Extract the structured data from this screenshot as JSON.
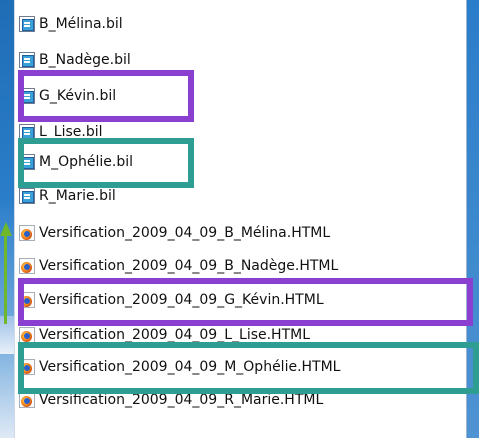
{
  "files": [
    {
      "name": "B_Mélina.bil",
      "icon": "bil-document-icon"
    },
    {
      "name": "B_Nadège.bil",
      "icon": "bil-document-icon"
    },
    {
      "name": "G_Kévin.bil",
      "icon": "bil-document-icon"
    },
    {
      "name": "L_Lise.bil",
      "icon": "bil-document-icon"
    },
    {
      "name": "M_Ophélie.bil",
      "icon": "bil-document-icon"
    },
    {
      "name": "R_Marie.bil",
      "icon": "bil-document-icon"
    },
    {
      "name": "Versification_2009_04_09_B_Mélina.HTML",
      "icon": "firefox-html-icon"
    },
    {
      "name": "Versification_2009_04_09_B_Nadège.HTML",
      "icon": "firefox-html-icon"
    },
    {
      "name": "Versification_2009_04_09_G_Kévin.HTML",
      "icon": "firefox-html-icon"
    },
    {
      "name": "Versification_2009_04_09_L_Lise.HTML",
      "icon": "firefox-html-icon"
    },
    {
      "name": "Versification_2009_04_09_M_Ophélie.HTML",
      "icon": "firefox-html-icon"
    },
    {
      "name": "Versification_2009_04_09_R_Marie.HTML",
      "icon": "firefox-html-icon"
    }
  ],
  "colors": {
    "highlight_purple": "#8b3fd1",
    "highlight_teal": "#2e9e93",
    "arrow_green": "#6fb82c",
    "background_blue": "#2a7dc9"
  }
}
